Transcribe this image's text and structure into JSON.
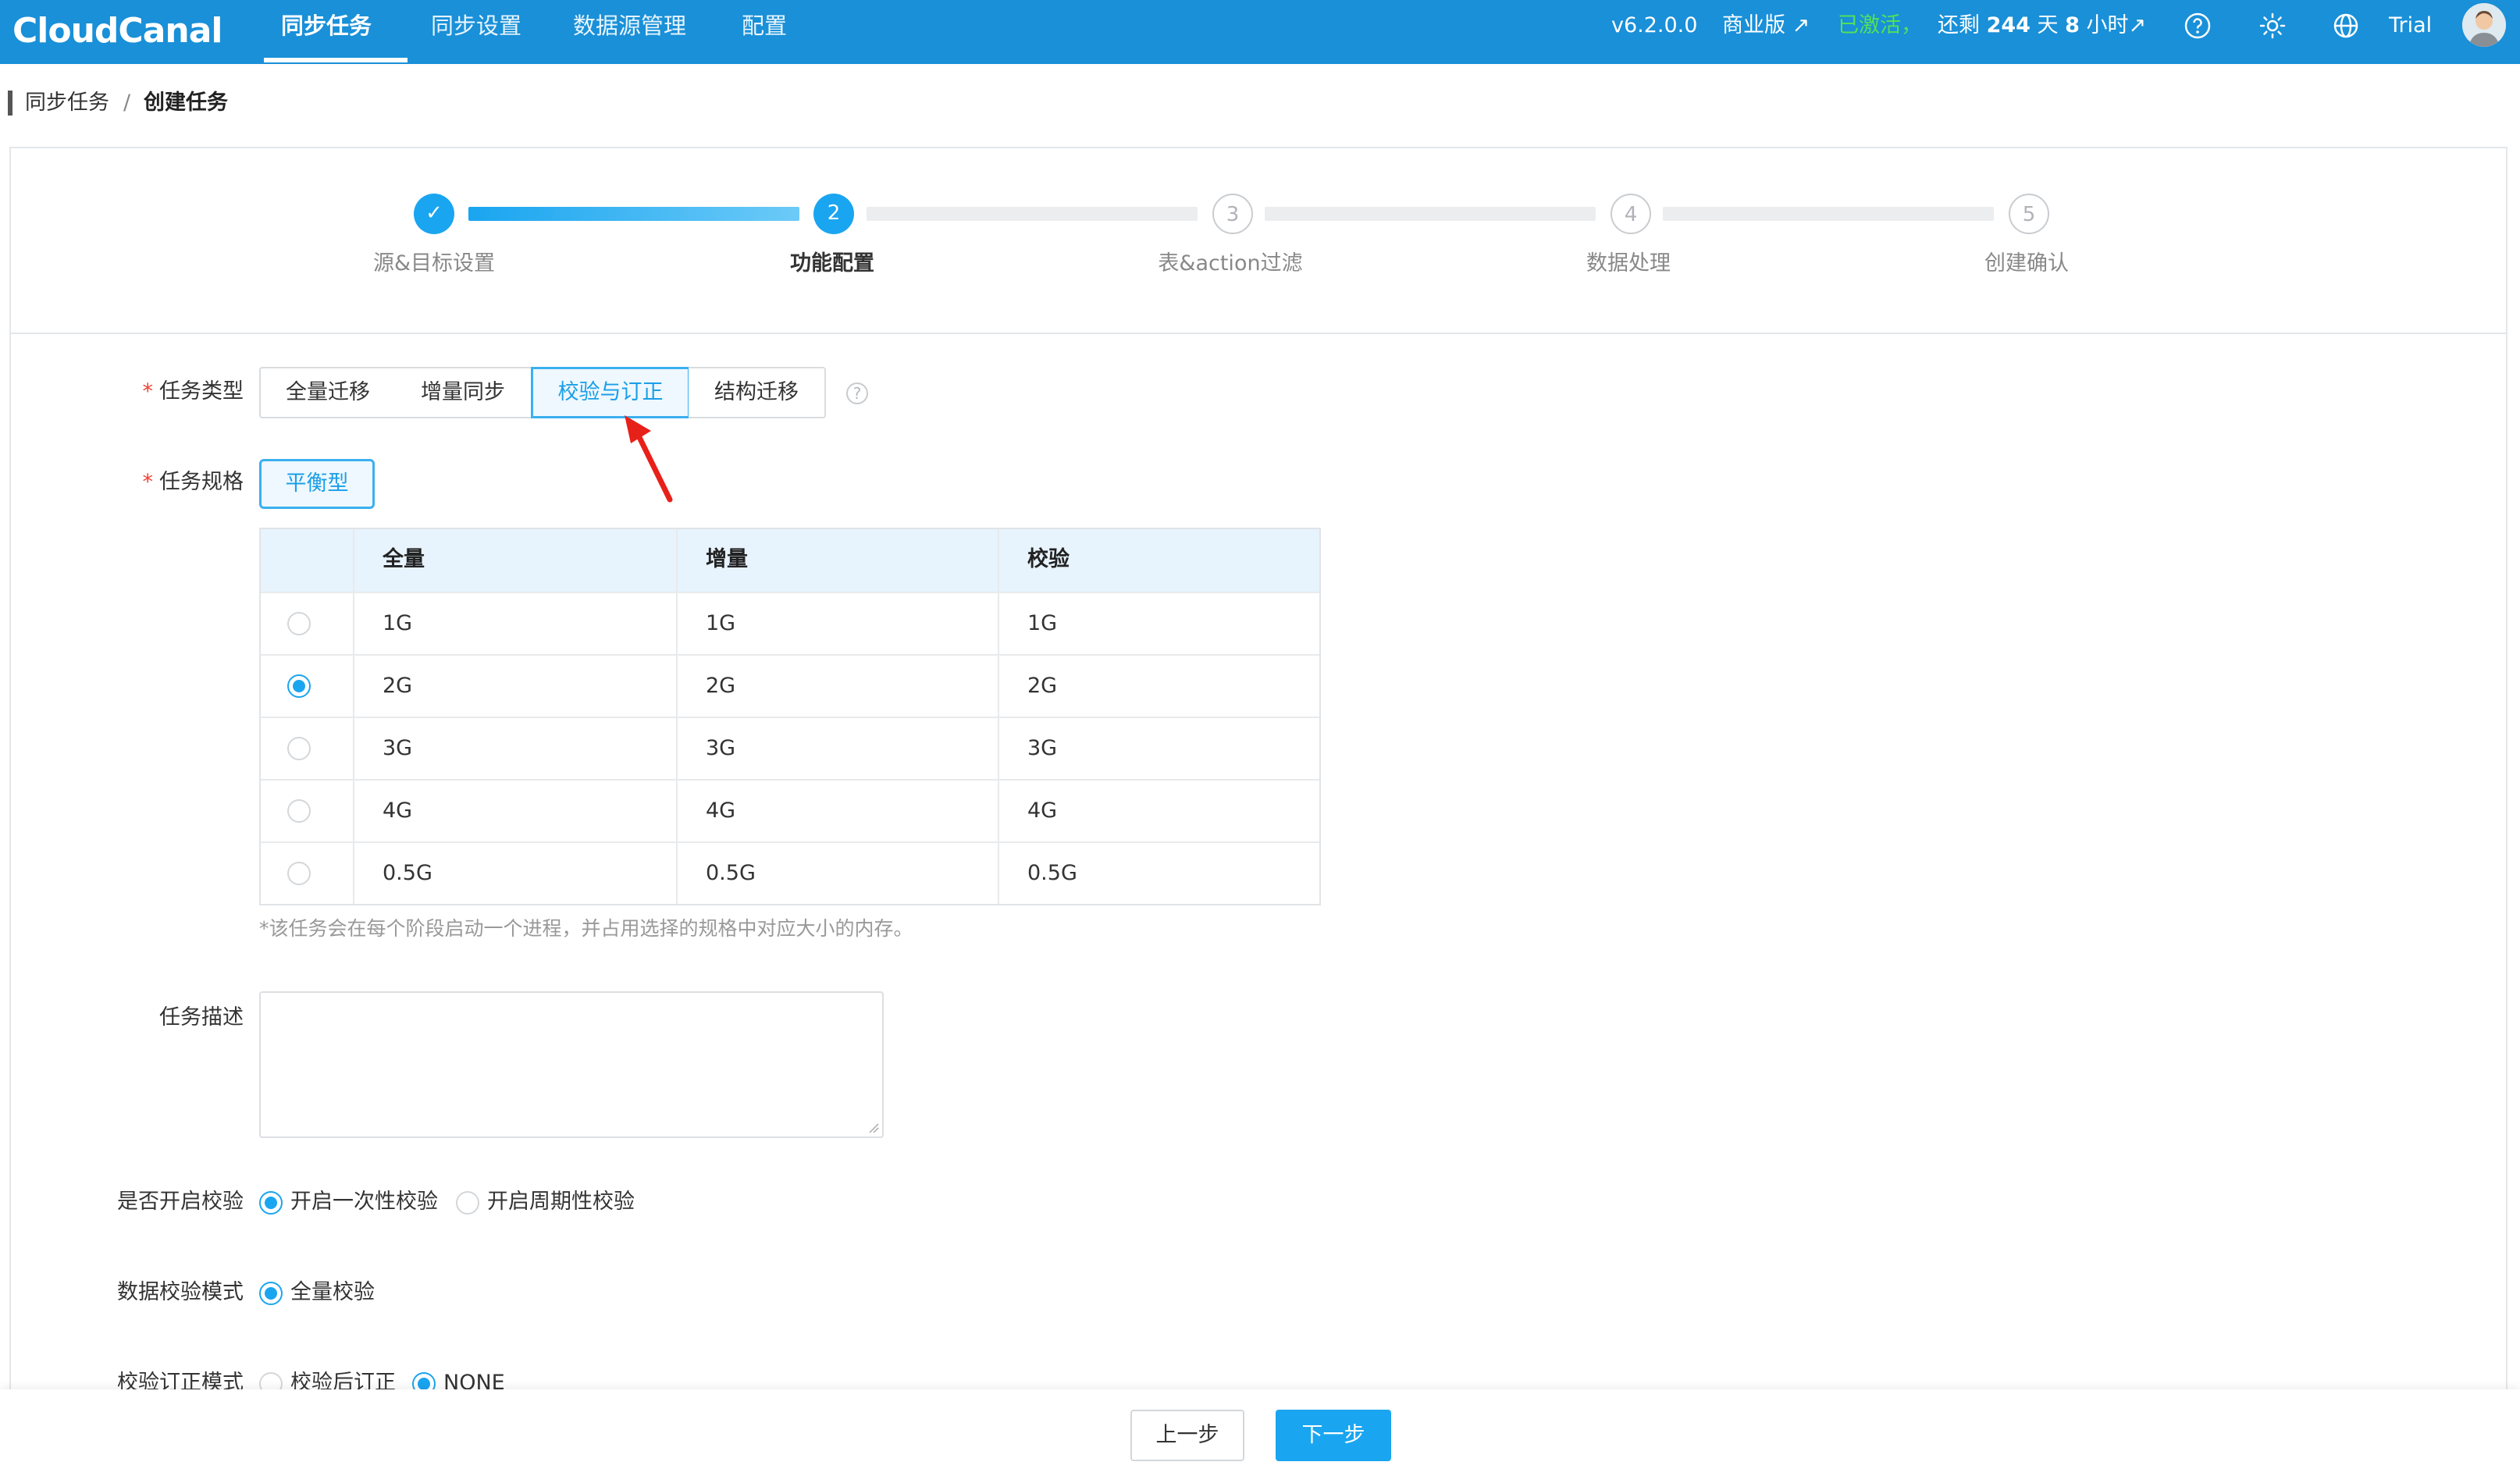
{
  "header": {
    "logo": "CloudCanal",
    "nav": [
      "同步任务",
      "同步设置",
      "数据源管理",
      "配置"
    ],
    "active_nav": "同步任务",
    "version": "v6.2.0.0",
    "edition": "商业版 ↗",
    "activated": "已激活，",
    "remaining_prefix": "还剩 ",
    "remaining_days": "244",
    "remaining_mid1": " 天 ",
    "remaining_hours": "8",
    "remaining_suffix": " 小时↗",
    "user": "Trial",
    "icons": [
      "help-icon",
      "theme-sun-icon",
      "language-globe-icon",
      "user-avatar"
    ]
  },
  "breadcrumb": {
    "parent": "同步任务",
    "separator": "/",
    "current": "创建任务"
  },
  "steps": [
    {
      "index": "✓",
      "label": "源&目标设置",
      "state": "done"
    },
    {
      "index": "2",
      "label": "功能配置",
      "state": "current"
    },
    {
      "index": "3",
      "label": "表&action过滤",
      "state": "todo"
    },
    {
      "index": "4",
      "label": "数据处理",
      "state": "todo"
    },
    {
      "index": "5",
      "label": "创建确认",
      "state": "todo"
    }
  ],
  "form": {
    "task_type": {
      "label": "任务类型",
      "required_mark": "*",
      "options": [
        "全量迁移",
        "增量同步",
        "校验与订正",
        "结构迁移"
      ],
      "selected": "校验与订正"
    },
    "task_spec": {
      "label": "任务规格",
      "required_mark": "*",
      "selected_spec": "平衡型",
      "table": {
        "columns": [
          "全量",
          "增量",
          "校验"
        ],
        "rows": [
          {
            "full": "1G",
            "incr": "1G",
            "check": "1G",
            "selected": false
          },
          {
            "full": "2G",
            "incr": "2G",
            "check": "2G",
            "selected": true
          },
          {
            "full": "3G",
            "incr": "3G",
            "check": "3G",
            "selected": false
          },
          {
            "full": "4G",
            "incr": "4G",
            "check": "4G",
            "selected": false
          },
          {
            "full": "0.5G",
            "incr": "0.5G",
            "check": "0.5G",
            "selected": false
          }
        ]
      },
      "hint": "*该任务会在每个阶段启动一个进程，并占用选择的规格中对应大小的内存。"
    },
    "description": {
      "label": "任务描述",
      "value": ""
    },
    "enable_check": {
      "label": "是否开启校验",
      "options": [
        "开启一次性校验",
        "开启周期性校验"
      ],
      "selected": "开启一次性校验"
    },
    "check_mode": {
      "label": "数据校验模式",
      "options": [
        "全量校验"
      ],
      "selected": "全量校验"
    },
    "fix_mode": {
      "label": "校验订正模式",
      "options": [
        "校验后订正",
        "NONE"
      ],
      "selected": "NONE"
    }
  },
  "footer": {
    "prev": "上一步",
    "next": "下一步"
  },
  "colors": {
    "header_bg": "#1990d8",
    "accent": "#1aa5f0",
    "activated_green": "#52e05a",
    "required_red": "#f04134",
    "annotation_arrow": "#e8201a"
  }
}
